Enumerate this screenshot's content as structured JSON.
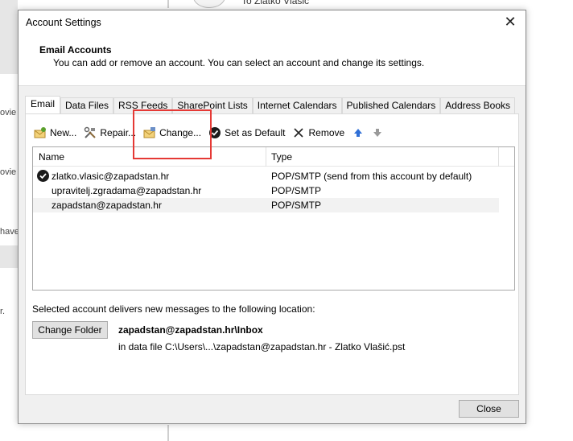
{
  "background": {
    "top_text": "To  Zlatko Vlašić",
    "left_fragments": [
      "ovie",
      "ovie",
      "have",
      "r."
    ]
  },
  "dialog": {
    "title": "Account Settings",
    "close_icon": "close-icon",
    "header_title": "Email Accounts",
    "header_subtitle": "You can add or remove an account. You can select an account and change its settings."
  },
  "tabs": [
    {
      "label": "Email",
      "active": true
    },
    {
      "label": "Data Files"
    },
    {
      "label": "RSS Feeds"
    },
    {
      "label": "SharePoint Lists"
    },
    {
      "label": "Internet Calendars"
    },
    {
      "label": "Published Calendars"
    },
    {
      "label": "Address Books"
    }
  ],
  "toolbar": {
    "new_label": "New...",
    "repair_label": "Repair...",
    "change_label": "Change...",
    "default_label": "Set as Default",
    "remove_label": "Remove",
    "move_up_icon": "arrow-up-icon",
    "move_down_icon": "arrow-down-icon"
  },
  "list": {
    "columns": {
      "name": "Name",
      "type": "Type"
    },
    "rows": [
      {
        "name": "zlatko.vlasic@zapadstan.hr",
        "type": "POP/SMTP (send from this account by default)",
        "default": true
      },
      {
        "name": "upravitelj.zgradama@zapadstan.hr",
        "type": "POP/SMTP"
      },
      {
        "name": "zapadstan@zapadstan.hr",
        "type": "POP/SMTP",
        "selected": true
      }
    ]
  },
  "location": {
    "label": "Selected account delivers new messages to the following location:",
    "change_folder_label": "Change Folder",
    "folder": "zapadstan@zapadstan.hr\\Inbox",
    "data_file": "in data file C:\\Users\\...\\zapadstan@zapadstan.hr - Zlatko Vlašić.pst"
  },
  "footer": {
    "close_label": "Close"
  },
  "colors": {
    "highlight": "#e53935",
    "arrow_blue": "#2f6fd6",
    "arrow_gray": "#9a9a9a"
  }
}
